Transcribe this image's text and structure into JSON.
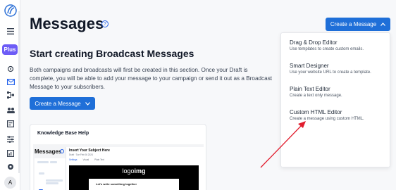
{
  "header": {
    "title": "Messages",
    "create_button": "Create a Message"
  },
  "sidebar": {
    "plus_badge": "Plus",
    "avatar_initial": "A"
  },
  "intro": {
    "title": "Start creating Broadcast Messages",
    "description": "Both campaigns and broadcasts will first be created in this section. Once your Draft is complete, you will be able to add your message to your campaign or send it out as a Broadcast Message to your subscribers.",
    "create_button": "Create a Message"
  },
  "knowledge_base": {
    "title": "Knowledge Base Help",
    "preview": {
      "page_title": "Messages",
      "editor_title": "Insert Your Subject Here",
      "meta": "Draft · Tue Feb 06 2024",
      "tabs": [
        "Settings",
        "Visual",
        "Plain Text"
      ],
      "logo_prefix": "logo",
      "logo_suffix": "img",
      "pane_text": "Let's write something together"
    }
  },
  "dropdown": {
    "items": [
      {
        "label": "Drag & Drop Editor",
        "description": "Use templates to create custom emails."
      },
      {
        "label": "Smart Designer",
        "description": "Use your website URL to create a template."
      },
      {
        "label": "Plain Text Editor",
        "description": "Create a text only message."
      },
      {
        "label": "Custom HTML Editor",
        "description": "Create a message using custom HTML."
      }
    ]
  },
  "colors": {
    "primary": "#1f6fd8",
    "plus": "#6d5cf6",
    "arrow": "#e11d2e"
  }
}
